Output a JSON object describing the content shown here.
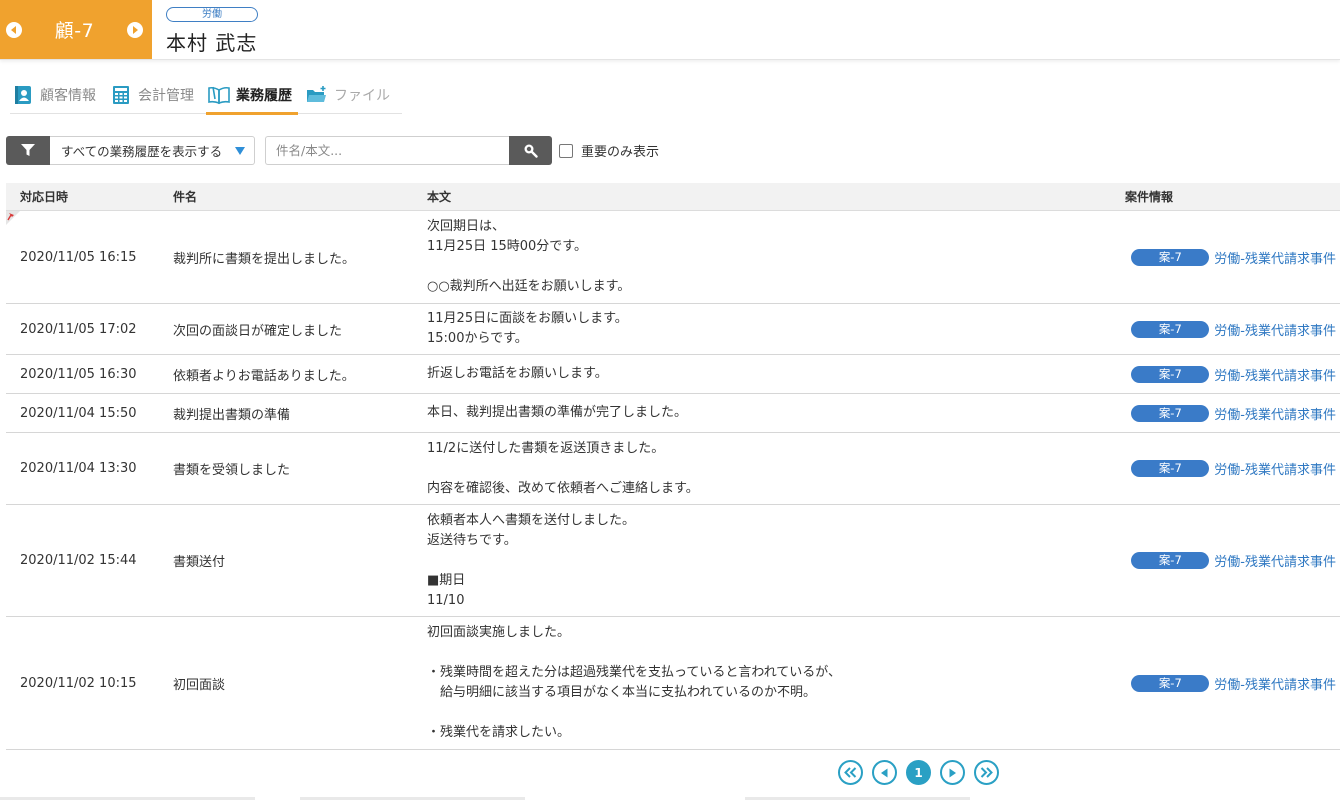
{
  "header": {
    "client_code": "顧-7",
    "category_badge": "労働",
    "client_name": "本村 武志"
  },
  "tabs": [
    {
      "label": "顧客情報",
      "icon": "contact-card-icon",
      "state": "normal"
    },
    {
      "label": "会計管理",
      "icon": "calculator-icon",
      "state": "normal"
    },
    {
      "label": "業務履歴",
      "icon": "open-book-icon",
      "state": "active"
    },
    {
      "label": "ファイル",
      "icon": "folder-add-icon",
      "state": "disabled"
    }
  ],
  "filter": {
    "selected": "すべての業務履歴を表示する",
    "search_placeholder": "件名/本文...",
    "search_value": "",
    "important_only_label": "重要のみ表示",
    "important_only_checked": false
  },
  "table": {
    "headers": {
      "date": "対応日時",
      "subject": "件名",
      "body": "本文",
      "case": "案件情報"
    },
    "rows": [
      {
        "date": "2020/11/05 16:15",
        "subject": "裁判所に書類を提出しました。",
        "body": "次回期日は、\n11月25日 15時00分です。\n\n○○裁判所へ出廷をお願いします。",
        "case_badge": "案-7",
        "case_name": "労働-残業代請求事件",
        "pinned": true
      },
      {
        "date": "2020/11/05 17:02",
        "subject": "次回の面談日が確定しました",
        "body": "11月25日に面談をお願いします。\n15:00からです。",
        "case_badge": "案-7",
        "case_name": "労働-残業代請求事件",
        "pinned": false
      },
      {
        "date": "2020/11/05 16:30",
        "subject": "依頼者よりお電話ありました。",
        "body": "折返しお電話をお願いします。",
        "case_badge": "案-7",
        "case_name": "労働-残業代請求事件",
        "pinned": false
      },
      {
        "date": "2020/11/04 15:50",
        "subject": "裁判提出書類の準備",
        "body": "本日、裁判提出書類の準備が完了しました。",
        "case_badge": "案-7",
        "case_name": "労働-残業代請求事件",
        "pinned": false
      },
      {
        "date": "2020/11/04 13:30",
        "subject": "書類を受領しました",
        "body": "11/2に送付した書類を返送頂きました。\n\n内容を確認後、改めて依頼者へご連絡します。",
        "case_badge": "案-7",
        "case_name": "労働-残業代請求事件",
        "pinned": false
      },
      {
        "date": "2020/11/02 15:44",
        "subject": "書類送付",
        "body": "依頼者本人へ書類を送付しました。\n返送待ちです。\n\n■期日\n11/10",
        "case_badge": "案-7",
        "case_name": "労働-残業代請求事件",
        "pinned": false
      },
      {
        "date": "2020/11/02 10:15",
        "subject": "初回面談",
        "body": "初回面談実施しました。\n\n・残業時間を超えた分は超過残業代を支払っていると言われているが、\n　給与明細に該当する項目がなく本当に支払われているのか不明。\n\n・残業代を請求したい。",
        "case_badge": "案-7",
        "case_name": "労働-残業代請求事件",
        "pinned": false
      }
    ]
  },
  "pagination": {
    "current_page": "1"
  },
  "colors": {
    "accent_orange": "#f0a22e",
    "badge_blue": "#3a7bc8",
    "link_blue": "#2f78c2",
    "pager_teal": "#2aa0c4"
  }
}
